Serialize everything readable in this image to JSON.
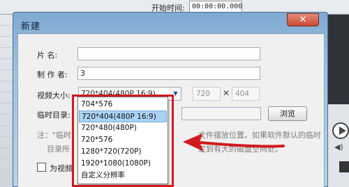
{
  "background": {
    "start_time_label": "开始时间:",
    "start_time_value": "00:00:00.000"
  },
  "dialog": {
    "title": "新建",
    "close_label": "✕",
    "fields": {
      "name_label": "片    名:",
      "name_value": "",
      "author_label": "制 作 者:",
      "author_value": "3",
      "size_label": "视频大小:",
      "size_value": "720*404(480P 16:9)",
      "width_value": "720",
      "x_symbol": "✕",
      "height_value": "404",
      "temp_dir_label": "临时目录:",
      "browse_label": "浏览"
    },
    "note": {
      "line1_start": "注：\"临时",
      "line1_end": "文件摆放位置。如果软件默认的临时",
      "line2_start": "目录所",
      "line2_end": "定到有大的磁盘空间处。"
    },
    "checkbox_label": "为视频"
  },
  "dropdown": {
    "options": [
      "704*576",
      "720*404(480P 16:9)",
      "720*480(480P)",
      "720*576",
      "1280*720(720P)",
      "1920*1080(1080P)",
      "自定义分辨率"
    ],
    "selected_index": 1
  },
  "colors": {
    "annotation_red": "#cf1a20",
    "selection_blue": "#a9d3f5",
    "dialog_frame": "#9cc0e0"
  }
}
